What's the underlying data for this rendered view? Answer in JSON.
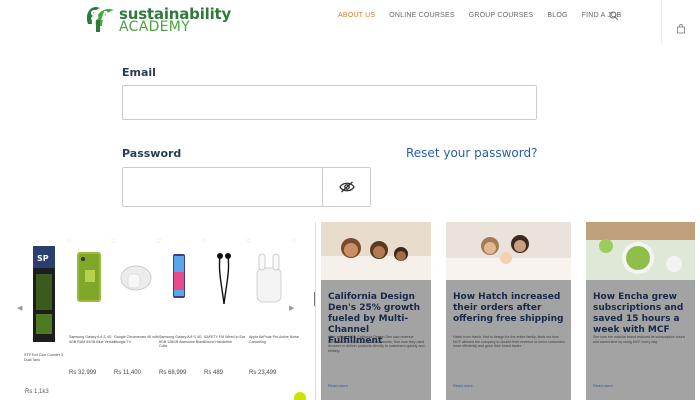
{
  "header": {
    "logo_line1": "sustainability",
    "logo_line2": "ACADEMY",
    "nav": [
      "ABOUT US",
      "ONLINE COURSES",
      "GROUP COURSES",
      "BLOG",
      "FIND A JOB"
    ],
    "active_nav": "ABOUT US",
    "search_icon": "search-icon",
    "cart_icon": "bag-icon"
  },
  "login": {
    "email_label": "Email",
    "email_value": "",
    "password_label": "Password",
    "password_value": "",
    "reset_link": "Reset your password?",
    "toggle_icon": "eye-slash-icon"
  },
  "products": {
    "items": [
      {
        "name": "STP Full Coin Counter 3 Dual Tank",
        "price": ""
      },
      {
        "name": "Samsung Galaxy A 8 S 4G 4GB RAM 64GB Blue Version",
        "price": "Rs 32,999"
      },
      {
        "name": "Google Chromecast 4K with Google TV",
        "price": "Rs 11,400"
      },
      {
        "name": "Samsung Galaxy A 8 S 4G 8GB 128GB Awesome Black Color",
        "price": "Rs 68,999"
      },
      {
        "name": "SAFETY FM Wired In Ear Sound Handsfree",
        "price": "Rs 489"
      },
      {
        "name": "Apple AirPods Pro Active Noise Cancelling",
        "price": "Rs 23,499"
      }
    ],
    "bottom_count": "Rs 1,1k3"
  },
  "articles": [
    {
      "title": "California Design Den's 25% growth fueled by Multi-Channel Fulfillment",
      "desc": "After selling MCF, California Design Den saw revenue increase 25% on its own sales channels. See how they used Amazon to deliver products directly to customers quickly and reliably.",
      "readmore": "Read more"
    },
    {
      "title": "How Hatch increased their orders after offering free shipping",
      "desc": "Hatch from Hatch, first to design for the entire family, finds out how MCF allowed the company to double their revenue to serve customers more efficiently and grow their brand faster.",
      "readmore": "Read more"
    },
    {
      "title": "How Encha grew subscriptions and saved 15 hours a week with MCF",
      "desc": "See how the matcha brand reduced its subscription churn and saved time by using MCF every day.",
      "readmore": "Read more"
    }
  ]
}
